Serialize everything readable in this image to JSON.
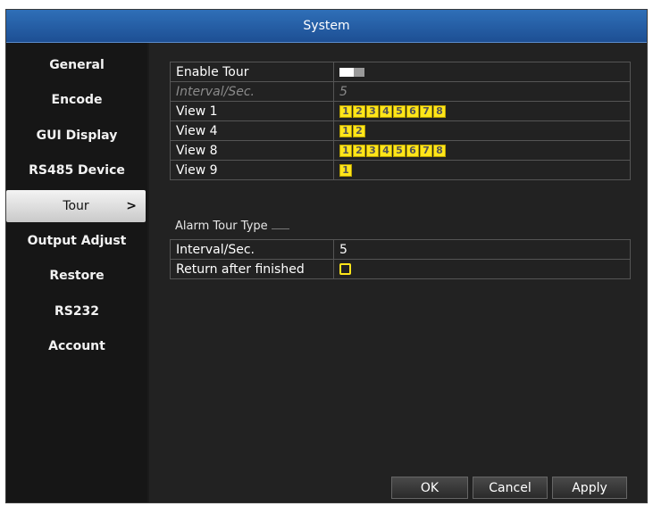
{
  "window": {
    "title": "System"
  },
  "sidebar": {
    "items": [
      {
        "label": "General"
      },
      {
        "label": "Encode"
      },
      {
        "label": "GUI Display"
      },
      {
        "label": "RS485 Device"
      },
      {
        "label": "Tour",
        "active": true
      },
      {
        "label": "Output Adjust"
      },
      {
        "label": "Restore"
      },
      {
        "label": "RS232"
      },
      {
        "label": "Account"
      }
    ],
    "active_chevron": ">"
  },
  "tour": {
    "enable_label": "Enable Tour",
    "interval_label": "Interval/Sec.",
    "interval_value": "5",
    "view1_label": "View 1",
    "view1_channels": [
      "1",
      "2",
      "3",
      "4",
      "5",
      "6",
      "7",
      "8"
    ],
    "view4_label": "View 4",
    "view4_channels": [
      "1",
      "2"
    ],
    "view8_label": "View 8",
    "view8_channels": [
      "1",
      "2",
      "3",
      "4",
      "5",
      "6",
      "7",
      "8"
    ],
    "view9_label": "View 9",
    "view9_channels": [
      "1"
    ]
  },
  "alarm": {
    "section_title": "Alarm Tour Type",
    "interval_label": "Interval/Sec.",
    "interval_value": "5",
    "return_label": "Return after finished"
  },
  "buttons": {
    "ok": "OK",
    "cancel": "Cancel",
    "apply": "Apply"
  },
  "colors": {
    "accent": "#ffe51a",
    "titlebar": "#2a63ad"
  }
}
